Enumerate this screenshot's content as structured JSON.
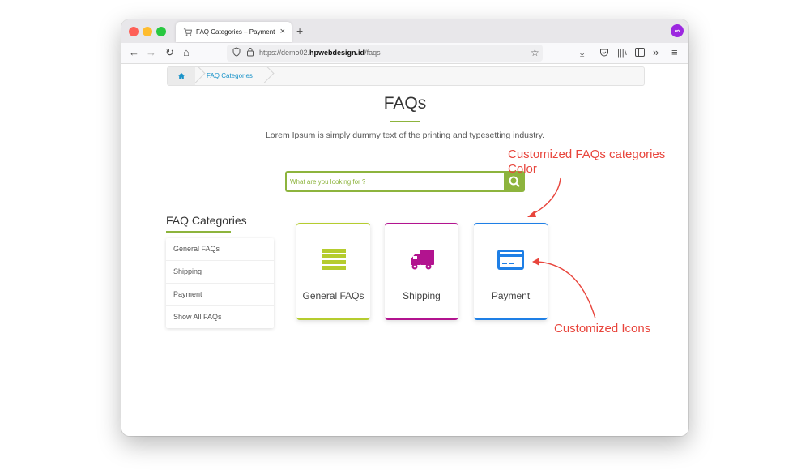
{
  "browser": {
    "tab": {
      "title": "FAQ Categories – Payment",
      "close": "×",
      "favicon": "cart-icon"
    },
    "new_tab": "+",
    "url": {
      "prefix": "https://demo02.",
      "domain": "hpwebdesign.id",
      "path": "/faqs"
    }
  },
  "breadcrumb": {
    "home_icon": "home-icon",
    "items": [
      "FAQ Categories"
    ]
  },
  "page": {
    "title": "FAQs",
    "subtitle": "Lorem Ipsum is simply dummy text of the printing and typesetting industry.",
    "accent_color": "#8db43d"
  },
  "search": {
    "placeholder": "What are you looking for ?",
    "button_icon": "search-icon"
  },
  "sidebar": {
    "title": "FAQ Categories",
    "items": [
      {
        "label": "General FAQs"
      },
      {
        "label": "Shipping"
      },
      {
        "label": "Payment"
      },
      {
        "label": "Show All FAQs"
      }
    ]
  },
  "categories": [
    {
      "label": "General FAQs",
      "color": "#b5cc2e",
      "icon": "list-icon"
    },
    {
      "label": "Shipping",
      "color": "#b2138f",
      "icon": "truck-icon"
    },
    {
      "label": "Payment",
      "color": "#1e7fe6",
      "icon": "credit-card-icon"
    }
  ],
  "annotations": {
    "colors_note_line1": "Customized FAQs categories",
    "colors_note_line2": "Color",
    "icons_note": "Customized Icons",
    "color": "#e8453c"
  }
}
